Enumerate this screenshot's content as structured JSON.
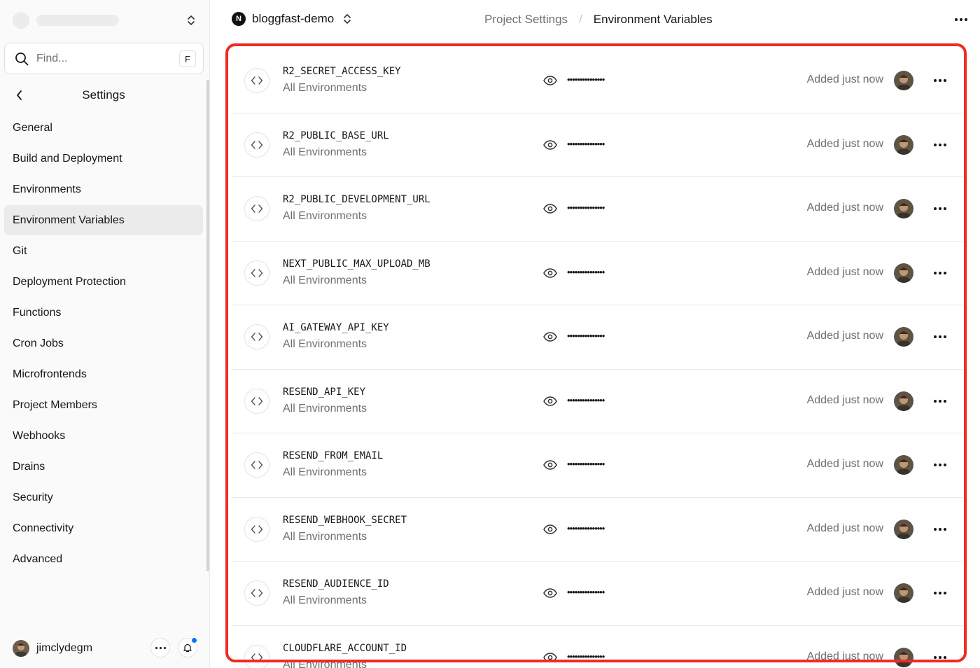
{
  "sidebar": {
    "search": {
      "placeholder": "Find...",
      "shortcut": "F"
    },
    "section_title": "Settings",
    "items": [
      {
        "label": "General",
        "active": false
      },
      {
        "label": "Build and Deployment",
        "active": false
      },
      {
        "label": "Environments",
        "active": false
      },
      {
        "label": "Environment Variables",
        "active": true
      },
      {
        "label": "Git",
        "active": false
      },
      {
        "label": "Deployment Protection",
        "active": false
      },
      {
        "label": "Functions",
        "active": false
      },
      {
        "label": "Cron Jobs",
        "active": false
      },
      {
        "label": "Microfrontends",
        "active": false
      },
      {
        "label": "Project Members",
        "active": false
      },
      {
        "label": "Webhooks",
        "active": false
      },
      {
        "label": "Drains",
        "active": false
      },
      {
        "label": "Security",
        "active": false
      },
      {
        "label": "Connectivity",
        "active": false
      },
      {
        "label": "Advanced",
        "active": false
      }
    ],
    "user": {
      "name": "jimclydegm",
      "has_notification": true
    }
  },
  "topbar": {
    "project_logo": "N",
    "project_name": "bloggfast-demo",
    "breadcrumb": {
      "parent": "Project Settings",
      "current": "Environment Variables"
    }
  },
  "env_vars": [
    {
      "name": "R2_SECRET_ACCESS_KEY",
      "scope": "All Environments",
      "value_masked": "•••••••••••••••",
      "added": "Added just now"
    },
    {
      "name": "R2_PUBLIC_BASE_URL",
      "scope": "All Environments",
      "value_masked": "•••••••••••••••",
      "added": "Added just now"
    },
    {
      "name": "R2_PUBLIC_DEVELOPMENT_URL",
      "scope": "All Environments",
      "value_masked": "•••••••••••••••",
      "added": "Added just now"
    },
    {
      "name": "NEXT_PUBLIC_MAX_UPLOAD_MB",
      "scope": "All Environments",
      "value_masked": "•••••••••••••••",
      "added": "Added just now"
    },
    {
      "name": "AI_GATEWAY_API_KEY",
      "scope": "All Environments",
      "value_masked": "•••••••••••••••",
      "added": "Added just now"
    },
    {
      "name": "RESEND_API_KEY",
      "scope": "All Environments",
      "value_masked": "•••••••••••••••",
      "added": "Added just now"
    },
    {
      "name": "RESEND_FROM_EMAIL",
      "scope": "All Environments",
      "value_masked": "•••••••••••••••",
      "added": "Added just now"
    },
    {
      "name": "RESEND_WEBHOOK_SECRET",
      "scope": "All Environments",
      "value_masked": "•••••••••••••••",
      "added": "Added just now"
    },
    {
      "name": "RESEND_AUDIENCE_ID",
      "scope": "All Environments",
      "value_masked": "•••••••••••••••",
      "added": "Added just now"
    },
    {
      "name": "CLOUDFLARE_ACCOUNT_ID",
      "scope": "All Environments",
      "value_masked": "•••••••••••••••",
      "added": "Added just now"
    }
  ],
  "colors": {
    "highlight": "#ef2b23",
    "notification": "#0a72ef",
    "active_nav": "#ebebeb"
  }
}
